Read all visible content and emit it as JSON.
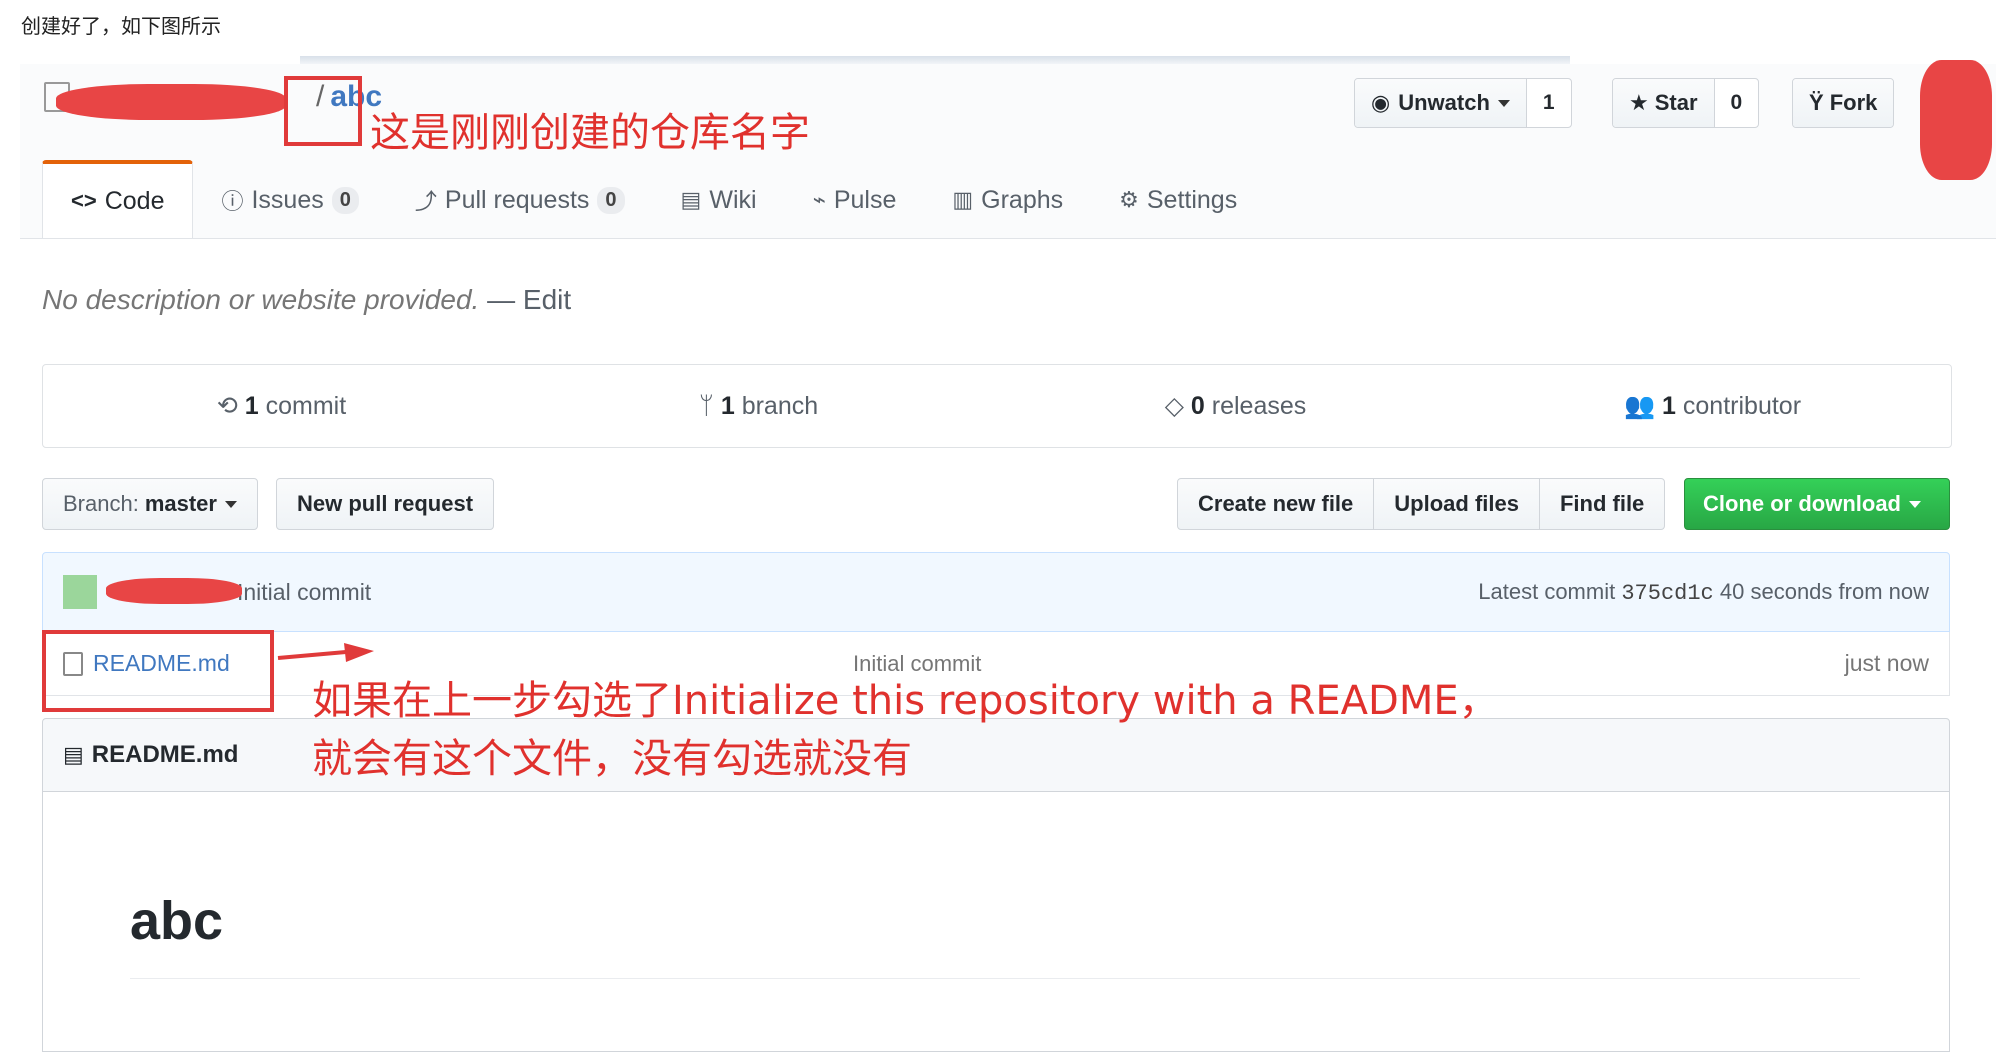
{
  "caption": "创建好了，如下图所示",
  "repo": {
    "name": "abc",
    "owner_separator": "/"
  },
  "header_actions": {
    "watch_label": "Unwatch",
    "watch_count": "1",
    "star_label": "Star",
    "star_count": "0",
    "fork_label": "Fork"
  },
  "tabs": [
    {
      "label": "Code",
      "icon": "code-icon"
    },
    {
      "label": "Issues",
      "count": "0",
      "icon": "issue-icon"
    },
    {
      "label": "Pull requests",
      "count": "0",
      "icon": "pull-request-icon"
    },
    {
      "label": "Wiki",
      "icon": "book-icon"
    },
    {
      "label": "Pulse",
      "icon": "pulse-icon"
    },
    {
      "label": "Graphs",
      "icon": "graph-icon"
    },
    {
      "label": "Settings",
      "icon": "gear-icon"
    }
  ],
  "description": {
    "text": "No description or website provided.",
    "edit": "— Edit"
  },
  "summary": {
    "commits_num": "1",
    "commits_label": "commit",
    "branches_num": "1",
    "branches_label": "branch",
    "releases_num": "0",
    "releases_label": "releases",
    "contributors_num": "1",
    "contributors_label": "contributor"
  },
  "branch_bar": {
    "branch_prefix": "Branch:",
    "branch_value": "master",
    "new_pr": "New pull request",
    "create_file": "Create new file",
    "upload_files": "Upload files",
    "find_file": "Find file",
    "clone": "Clone or download"
  },
  "commit": {
    "message": "Initial commit",
    "latest_prefix": "Latest commit",
    "sha": "375cd1c",
    "age": "40 seconds from now"
  },
  "files": [
    {
      "name": "README.md",
      "message": "Initial commit",
      "age": "just now"
    }
  ],
  "readme": {
    "title": "README.md",
    "heading": "abc"
  },
  "annotations": {
    "repo_note": "这是刚刚创建的仓库名字",
    "readme_note_line1": "如果在上一步勾选了Initialize this repository with a README，",
    "readme_note_line2": "就会有这个文件，没有勾选就没有",
    "color": "#e0312d"
  }
}
